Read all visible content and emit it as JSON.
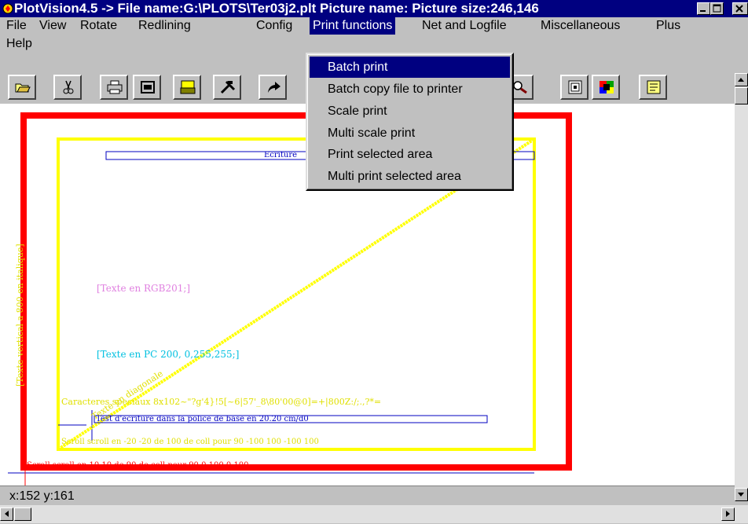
{
  "window": {
    "title": "PlotVision4.5 -> File name:G:\\PLOTS\\Ter03j2.plt Picture name: Picture size:246,146",
    "controls": [
      "minimize-icon",
      "maximize-icon",
      "close-icon"
    ]
  },
  "menu": {
    "file": "File",
    "view": "View",
    "rotate": "Rotate",
    "redlining": "Redlining",
    "config": "Config",
    "print_functions": "Print functions",
    "net_logfile": "Net and Logfile",
    "miscellaneous": "Miscellaneous",
    "plus": "Plus",
    "help": "Help"
  },
  "print_menu": {
    "items": [
      "Batch print",
      "Batch copy file to printer",
      "Scale print",
      "Multi scale print",
      "Print selected area",
      "Multi print selected area"
    ],
    "highlighted": "Batch print"
  },
  "toolbar": {
    "icons": [
      "open-folder-icon",
      "scissors-icon",
      "printer-icon",
      "print-preview-icon",
      "plotter-icon",
      "tools-icon",
      "redo-arrow-icon",
      "zoom-icon",
      "grid-icon",
      "color-palette-icon",
      "notepad-icon"
    ]
  },
  "plot": {
    "texts": {
      "ecriture": "Ecriture",
      "texte_pink": "[Texte en RGB201;]",
      "texte_cyan": "[Texte en PC 200, 0,255,255;]",
      "vertical": "[Texte vertical a 800 en italique]",
      "diagonal": "Texte en diagonale",
      "caracteres": "Caracteres speciaux 8x102~\"?g'4}!5[~6|57'_8\\80'00@0]=+|800Z:/;.,?*=",
      "test_ecriture": "Test d'ecriture dans la police de base en 20.20 cm/d0",
      "scroll_yellow": "Scroll scroll en -20 -20 de 100 de coll pour 90 -100 100 -100 100",
      "scroll_red": "Scroll scroll en 10 10 de 90 de coll pour 90 0 100 0 100"
    },
    "colors": {
      "frame": "#ff0000",
      "border": "#ffff00",
      "line": "#0000c0",
      "pink": "#e080e0",
      "cyan": "#00c0e0"
    }
  },
  "status": {
    "coords": "x:152 y:161"
  }
}
